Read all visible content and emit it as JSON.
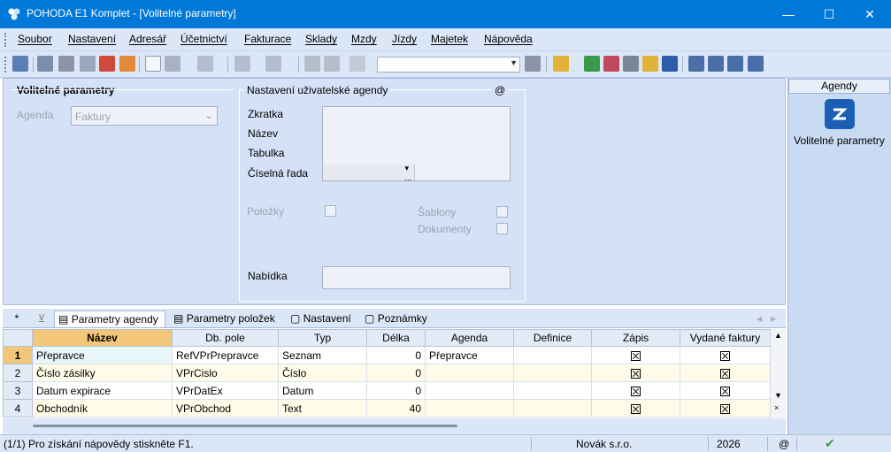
{
  "window": {
    "title": "POHODA E1 Komplet - [Volitelné parametry]"
  },
  "menu": [
    "Soubor",
    "Nastavení",
    "Adresář",
    "Účetnictví",
    "Fakturace",
    "Sklady",
    "Mzdy",
    "Jízdy",
    "Majetek",
    "Nápověda"
  ],
  "toolbar": {
    "search_value": ""
  },
  "form": {
    "section_title": "Volitelné parametry",
    "agenda_label": "Agenda",
    "agenda_value": "Faktury",
    "user_agenda_title": "Nastavení uživatelské agendy",
    "at_symbol": "@",
    "zkratka_label": "Zkratka",
    "nazev_label": "Název",
    "tabulka_label": "Tabulka",
    "ciselna_rada_label": "Číselná řada",
    "polozky_label": "Položky",
    "sablony_label": "Šablony",
    "dokumenty_label": "Dokumenty",
    "nabidka_label": "Nabídka"
  },
  "tabs": [
    "Parametry agendy",
    "Parametry položek",
    "Nastavení",
    "Poznámky"
  ],
  "table": {
    "columns": [
      "Název",
      "Db. pole",
      "Typ",
      "Délka",
      "Agenda",
      "Definice",
      "Zápis",
      "Vydané faktury"
    ],
    "rows": [
      {
        "n": "1",
        "nazev": "Přepravce",
        "pole": "RefVPrPrepravce",
        "typ": "Seznam",
        "delka": "0",
        "agenda": "Přepravce",
        "definice": "",
        "zapis": true,
        "vydane": true
      },
      {
        "n": "2",
        "nazev": "Číslo zásilky",
        "pole": "VPrCislo",
        "typ": "Číslo",
        "delka": "0",
        "agenda": "",
        "definice": "",
        "zapis": true,
        "vydane": true
      },
      {
        "n": "3",
        "nazev": "Datum expirace",
        "pole": "VPrDatEx",
        "typ": "Datum",
        "delka": "0",
        "agenda": "",
        "definice": "",
        "zapis": true,
        "vydane": true
      },
      {
        "n": "4",
        "nazev": "Obchodník",
        "pole": "VPrObchod",
        "typ": "Text",
        "delka": "40",
        "agenda": "",
        "definice": "",
        "zapis": true,
        "vydane": true
      }
    ]
  },
  "agenda_panel": {
    "header": "Agendy",
    "item_label": "Volitelné parametry"
  },
  "status": {
    "help": "(1/1) Pro získání nápovědy stiskněte F1.",
    "company": "Novák s.r.o.",
    "year": "2026",
    "at": "@"
  }
}
